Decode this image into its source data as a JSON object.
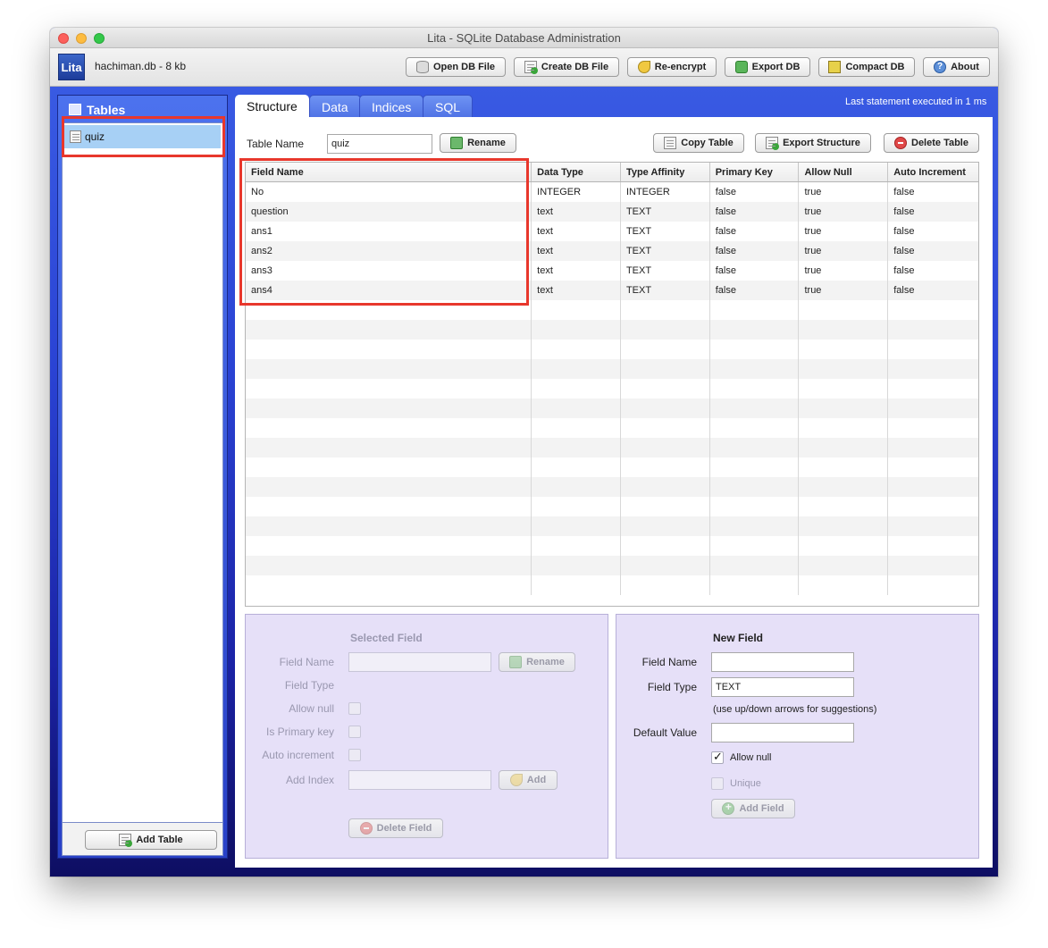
{
  "window": {
    "title": "Lita - SQLite Database Administration"
  },
  "toolbar": {
    "logo": "Lita",
    "db_info": "hachiman.db - 8 kb",
    "buttons": {
      "open": "Open DB File",
      "create": "Create DB File",
      "reencrypt": "Re-encrypt",
      "export": "Export DB",
      "compact": "Compact DB",
      "about": "About"
    }
  },
  "sidebar": {
    "title": "Tables",
    "items": [
      {
        "label": "quiz"
      }
    ],
    "add_table": "Add Table"
  },
  "status": {
    "message": "Last statement executed in 1 ms"
  },
  "tabs": [
    {
      "label": "Structure",
      "active": true
    },
    {
      "label": "Data"
    },
    {
      "label": "Indices"
    },
    {
      "label": "SQL"
    }
  ],
  "structure": {
    "table_name_label": "Table Name",
    "table_name_value": "quiz",
    "rename": "Rename",
    "copy_table": "Copy Table",
    "export_structure": "Export Structure",
    "delete_table": "Delete Table",
    "columns": [
      "Field Name",
      "Data Type",
      "Type Affinity",
      "Primary Key",
      "Allow Null",
      "Auto Increment"
    ],
    "rows": [
      [
        "No",
        "INTEGER",
        "INTEGER",
        "false",
        "true",
        "false"
      ],
      [
        "question",
        "text",
        "TEXT",
        "false",
        "true",
        "false"
      ],
      [
        "ans1",
        "text",
        "TEXT",
        "false",
        "true",
        "false"
      ],
      [
        "ans2",
        "text",
        "TEXT",
        "false",
        "true",
        "false"
      ],
      [
        "ans3",
        "text",
        "TEXT",
        "false",
        "true",
        "false"
      ],
      [
        "ans4",
        "text",
        "TEXT",
        "false",
        "true",
        "false"
      ]
    ]
  },
  "selected_field": {
    "title": "Selected Field",
    "field_name": "Field Name",
    "field_type": "Field Type",
    "allow_null": "Allow null",
    "is_primary_key": "Is Primary key",
    "auto_increment": "Auto increment",
    "add_index": "Add Index",
    "rename": "Rename",
    "add": "Add",
    "delete_field": "Delete Field"
  },
  "new_field": {
    "title": "New Field",
    "field_name": "Field Name",
    "field_type": "Field Type",
    "field_type_value": "TEXT",
    "hint": "(use up/down arrows for suggestions)",
    "default_value": "Default Value",
    "allow_null": "Allow null",
    "unique": "Unique",
    "add_field": "Add Field"
  }
}
